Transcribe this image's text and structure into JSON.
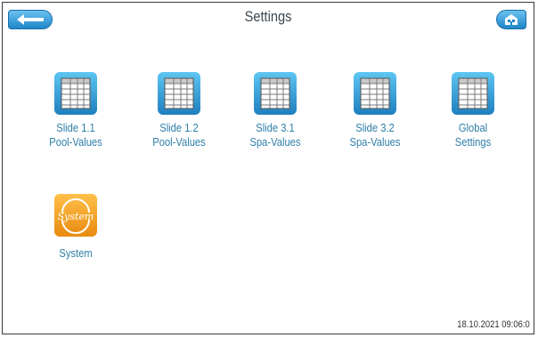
{
  "header": {
    "title": "Settings"
  },
  "tiles": [
    {
      "line1": "Slide 1.1",
      "line2": "Pool-Values",
      "icon": "table-icon"
    },
    {
      "line1": "Slide 1.2",
      "line2": "Pool-Values",
      "icon": "table-icon"
    },
    {
      "line1": "Slide 3.1",
      "line2": "Spa-Values",
      "icon": "table-icon"
    },
    {
      "line1": "Slide 3.2",
      "line2": "Spa-Values",
      "icon": "table-icon"
    },
    {
      "line1": "Global",
      "line2": "Settings",
      "icon": "table-icon"
    },
    {
      "line1": "System",
      "line2": "",
      "icon": "system-icon"
    }
  ],
  "system_icon_text": "System",
  "status": {
    "timestamp": "18.10.2021 09:06:0"
  },
  "colors": {
    "accent": "#2e7ea8",
    "nav_button": "#1e86c9",
    "system_orange": "#f0a020"
  }
}
